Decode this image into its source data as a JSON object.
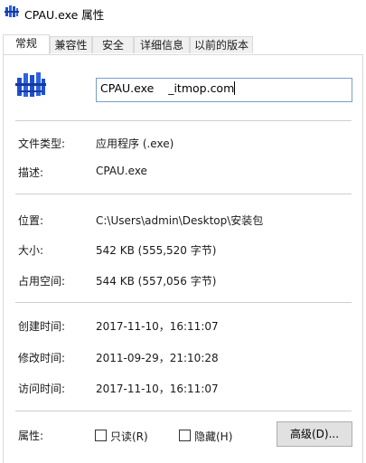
{
  "window": {
    "title": "CPAU.exe 属性"
  },
  "tabs": [
    {
      "label": "常规",
      "active": true
    },
    {
      "label": "兼容性",
      "active": false
    },
    {
      "label": "安全",
      "active": false
    },
    {
      "label": "详细信息",
      "active": false
    },
    {
      "label": "以前的版本",
      "active": false
    }
  ],
  "general": {
    "file_name": "CPAU.exe    _itmop.com",
    "file_type_label": "文件类型:",
    "file_type_value": "应用程序 (.exe)",
    "description_label": "描述:",
    "description_value": "CPAU.exe",
    "location_label": "位置:",
    "location_value": "C:\\Users\\admin\\Desktop\\安装包",
    "size_label": "大小:",
    "size_value": "542 KB (555,520 字节)",
    "size_on_disk_label": "占用空间:",
    "size_on_disk_value": "544 KB (557,056 字节)",
    "created_label": "创建时间:",
    "created_value": "2017-11-10，16:11:07",
    "modified_label": "修改时间:",
    "modified_value": "2011-09-29，21:10:28",
    "accessed_label": "访问时间:",
    "accessed_value": "2017-11-10，16:11:07",
    "attributes_label": "属性:",
    "readonly_label": "只读(R)",
    "readonly_checked": false,
    "hidden_label": "隐藏(H)",
    "hidden_checked": false,
    "advanced_button": "高级(D)..."
  },
  "icons": {
    "title": "exe-app-icon",
    "file": "exe-app-icon"
  },
  "colors": {
    "input_border": "#7a9fc8",
    "icon_blue": "#1e4fd1"
  }
}
